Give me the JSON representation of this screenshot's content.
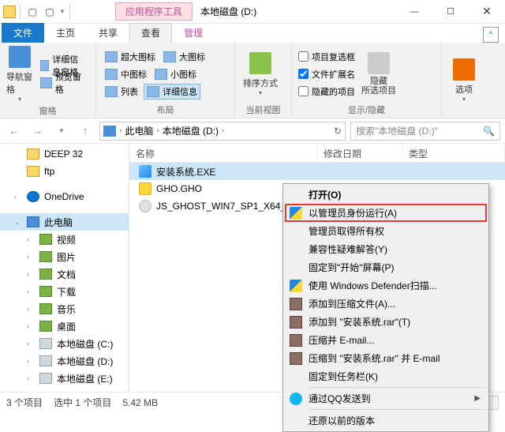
{
  "title": {
    "tools_label": "应用程序工具",
    "text": "本地磁盘 (D:)"
  },
  "tabs": {
    "file": "文件",
    "home": "主页",
    "share": "共享",
    "view": "查看",
    "manage": "管理"
  },
  "ribbon": {
    "panes": {
      "nav_pane": "导航窗格",
      "preview": "预览窗格",
      "details_pane": "详细信息窗格"
    },
    "layout": {
      "xl_icons": "超大图标",
      "l_icons": "大图标",
      "m_icons": "中图标",
      "s_icons": "小图标",
      "list": "列表",
      "details": "详细信息"
    },
    "currentview": {
      "sort": "排序方式"
    },
    "showhide": {
      "checkboxes": "项目复选框",
      "extensions": "文件扩展名",
      "hidden": "隐藏的项目",
      "hide_btn": "隐藏\n所选项目"
    },
    "options": "选项",
    "groups": {
      "panes": "窗格",
      "layout": "布局",
      "currentview": "当前视图",
      "showhide": "显示/隐藏"
    }
  },
  "address": {
    "thispc": "此电脑",
    "drive": "本地磁盘 (D:)",
    "search_placeholder": "搜索\"本地磁盘 (D:)\""
  },
  "tree": {
    "deep32": "DEEP 32",
    "ftp": "ftp",
    "onedrive": "OneDrive",
    "thispc": "此电脑",
    "videos": "视频",
    "pictures": "图片",
    "documents": "文档",
    "downloads": "下载",
    "music": "音乐",
    "desktop": "桌面",
    "drive_c": "本地磁盘 (C:)",
    "drive_d": "本地磁盘 (D:)",
    "drive_e": "本地磁盘 (E:)"
  },
  "columns": {
    "name": "名称",
    "date": "修改日期",
    "type": "类型"
  },
  "files": [
    {
      "name": "安装系统.EXE",
      "kind": "exe"
    },
    {
      "name": "GHO.GHO",
      "kind": "gho"
    },
    {
      "name": "JS_GHOST_WIN7_SP1_X64_...",
      "kind": "iso"
    }
  ],
  "status": {
    "count": "3 个项目",
    "selected": "选中 1 个项目",
    "size": "5.42 MB"
  },
  "ctx": {
    "open": "打开(O)",
    "run_admin": "以管理员身份运行(A)",
    "admin_ownership": "管理员取得所有权",
    "troubleshoot": "兼容性疑难解答(Y)",
    "pin_start": "固定到\"开始\"屏幕(P)",
    "defender": "使用 Windows Defender扫描...",
    "add_archive": "添加到压缩文件(A)...",
    "add_rar": "添加到 \"安装系统.rar\"(T)",
    "compress_email": "压缩并 E-mail...",
    "compress_rar_email": "压缩到 \"安装系统.rar\" 并 E-mail",
    "pin_taskbar": "固定到任务栏(K)",
    "qq_send": "通过QQ发送到",
    "restore_prev": "还原以前的版本"
  }
}
